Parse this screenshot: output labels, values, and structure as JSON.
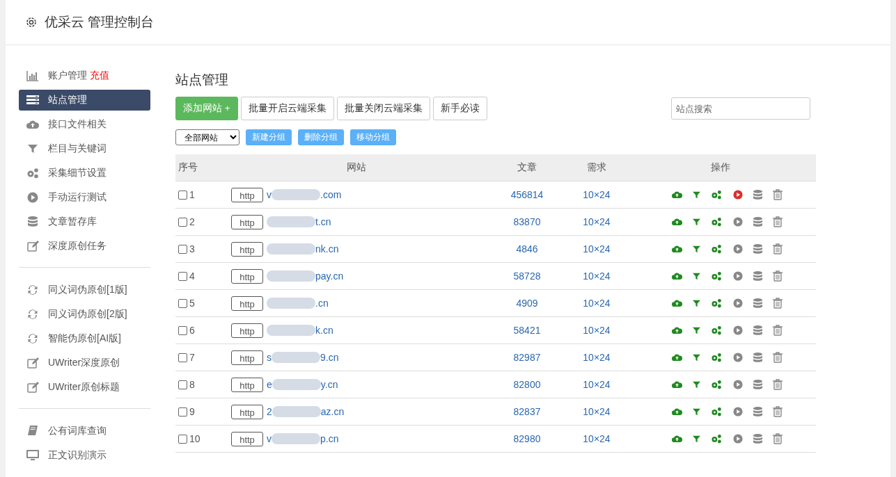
{
  "header": {
    "title": "优采云 管理控制台"
  },
  "sidebar": {
    "groups": [
      {
        "items": [
          {
            "label": "账户管理",
            "badge": "充值",
            "selected": false
          },
          {
            "label": "站点管理",
            "selected": true
          },
          {
            "label": "接口文件相关",
            "selected": false
          },
          {
            "label": "栏目与关键词",
            "selected": false
          },
          {
            "label": "采集细节设置",
            "selected": false
          },
          {
            "label": "手动运行测试",
            "selected": false
          },
          {
            "label": "文章暂存库",
            "selected": false
          },
          {
            "label": "深度原创任务",
            "selected": false
          }
        ]
      },
      {
        "items": [
          {
            "label": "同义词伪原创[1版]",
            "selected": false
          },
          {
            "label": "同义词伪原创[2版]",
            "selected": false
          },
          {
            "label": "智能伪原创[AI版]",
            "selected": false
          },
          {
            "label": "UWriter深度原创",
            "selected": false
          },
          {
            "label": "UWriter原创标题",
            "selected": false
          }
        ]
      },
      {
        "items": [
          {
            "label": "公有词库查询",
            "selected": false
          },
          {
            "label": "正文识别演示",
            "selected": false
          }
        ]
      }
    ]
  },
  "main": {
    "title": "站点管理",
    "toolbar": [
      {
        "label": "添加网站 +",
        "kind": "primary"
      },
      {
        "label": "批量开启云端采集",
        "kind": "default"
      },
      {
        "label": "批量关闭云端采集",
        "kind": "default"
      },
      {
        "label": "新手必读",
        "kind": "default"
      }
    ],
    "search": {
      "placeholder": "站点搜索"
    },
    "group_select": {
      "value": "全部网站"
    },
    "group_buttons": [
      "新建分组",
      "删除分组",
      "移动分组"
    ],
    "table": {
      "columns": [
        "序号",
        "网站",
        "文章",
        "需求",
        "操作"
      ],
      "rows": [
        {
          "number": "1",
          "checked": false,
          "scheme": "http",
          "domain_start": "v",
          "domain_end": ".com",
          "articles": "456814",
          "demand": "10×24",
          "running": true
        },
        {
          "number": "2",
          "checked": false,
          "scheme": "http",
          "domain_end": "t.cn",
          "articles": "83870",
          "demand": "10×24",
          "running": false
        },
        {
          "number": "3",
          "checked": false,
          "scheme": "http",
          "domain_end": "nk.cn",
          "articles": "4846",
          "demand": "10×24",
          "running": false
        },
        {
          "number": "4",
          "checked": false,
          "scheme": "http",
          "domain_end": "pay.cn",
          "articles": "58728",
          "demand": "10×24",
          "running": false
        },
        {
          "number": "5",
          "checked": false,
          "scheme": "http",
          "domain_end": ".cn",
          "articles": "4909",
          "demand": "10×24",
          "running": false
        },
        {
          "number": "6",
          "checked": false,
          "scheme": "http",
          "domain_end": "k.cn",
          "articles": "58421",
          "demand": "10×24",
          "running": false
        },
        {
          "number": "7",
          "checked": false,
          "scheme": "http",
          "domain_start": "s",
          "domain_end": "9.cn",
          "articles": "82987",
          "demand": "10×24",
          "running": false
        },
        {
          "number": "8",
          "checked": false,
          "scheme": "http",
          "domain_start": "e",
          "domain_end": "y.cn",
          "articles": "82800",
          "demand": "10×24",
          "running": false
        },
        {
          "number": "9",
          "checked": false,
          "scheme": "http",
          "domain_start": "2",
          "domain_end": "az.cn",
          "articles": "82837",
          "demand": "10×24",
          "running": false
        },
        {
          "number": "10",
          "checked": false,
          "scheme": "http",
          "domain_start": "v",
          "domain_end": "p.cn",
          "articles": "82980",
          "demand": "10×24",
          "running": false
        }
      ]
    }
  }
}
